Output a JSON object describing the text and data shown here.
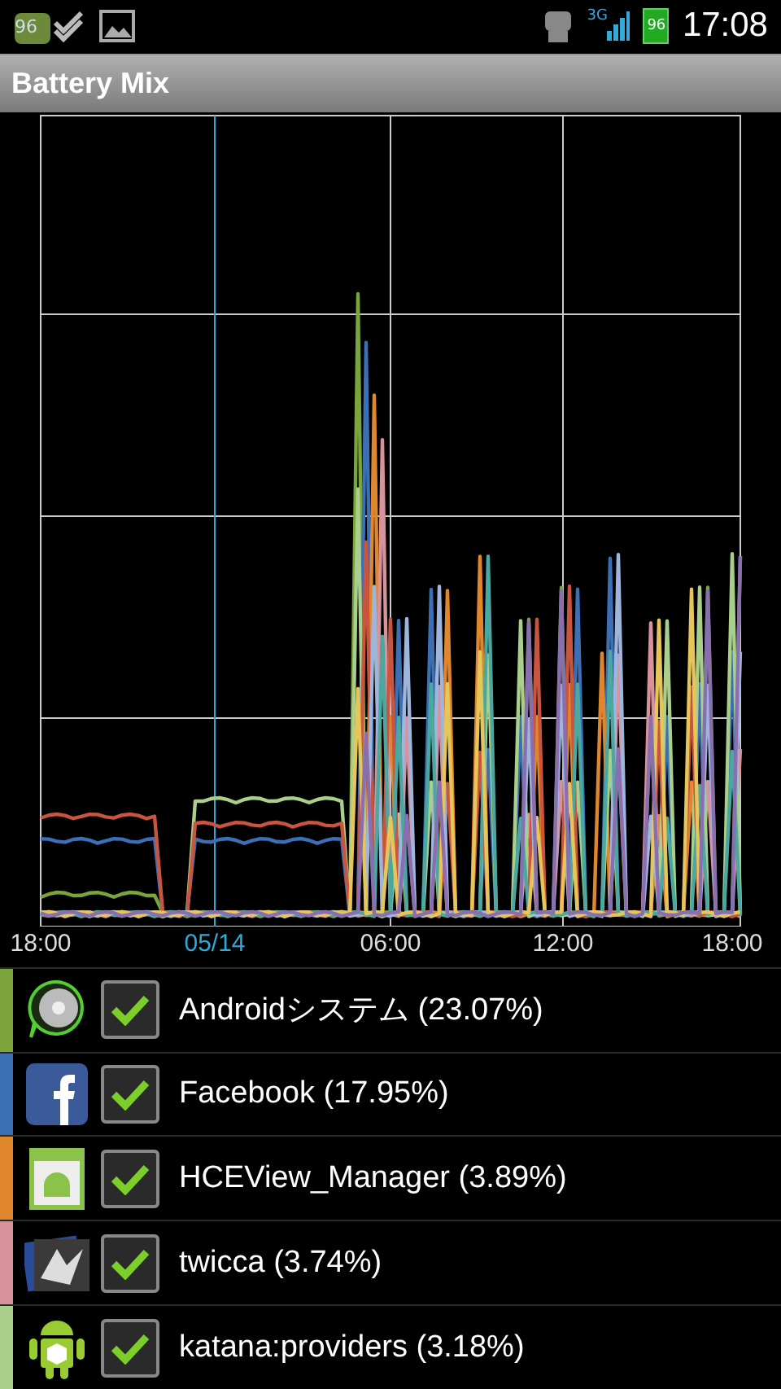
{
  "status_bar": {
    "notification_badge": "96",
    "battery_badge": "96",
    "time": "17:08",
    "network": "3G"
  },
  "title": "Battery Mix",
  "chart": {
    "x_labels": [
      {
        "label": "18:00",
        "kind": "time"
      },
      {
        "label": "05/14",
        "kind": "date"
      },
      {
        "label": "06:00",
        "kind": "time"
      },
      {
        "label": "12:00",
        "kind": "time"
      },
      {
        "label": "18:00",
        "kind": "time"
      }
    ]
  },
  "apps": [
    {
      "name": "Androidシステム (23.07%)",
      "checked": true,
      "color": "#7ca43c"
    },
    {
      "name": "Facebook (17.95%)",
      "checked": true,
      "color": "#3d6fb4"
    },
    {
      "name": "HCEView_Manager (3.89%)",
      "checked": true,
      "color": "#e0872e"
    },
    {
      "name": "twicca (3.74%)",
      "checked": true,
      "color": "#d8929c"
    },
    {
      "name": "katana:providers (3.18%)",
      "checked": true,
      "color": "#a9cf8a"
    }
  ]
}
